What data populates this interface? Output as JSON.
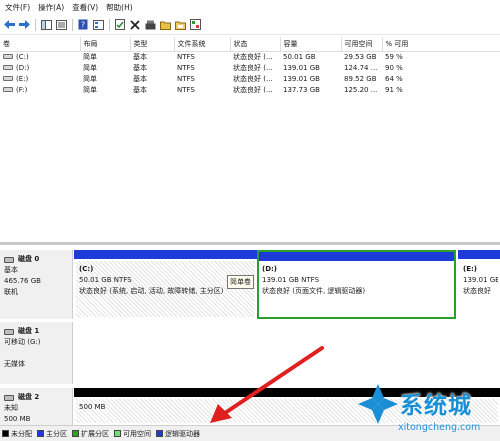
{
  "menu": [
    "文件(F)",
    "操作(A)",
    "查看(V)",
    "帮助(H)"
  ],
  "toolbar_icons": [
    "back-icon",
    "forward-icon",
    "console-tree-icon",
    "properties-icon",
    "help-icon",
    "refresh-icon",
    "delete-icon",
    "open-icon",
    "folder-icon",
    "export-icon",
    "settings-icon"
  ],
  "volume_table": {
    "columns": [
      "卷",
      "布局",
      "类型",
      "文件系统",
      "状态",
      "容量",
      "可用空间",
      "% 可用"
    ],
    "rows": [
      {
        "volume": "(C:)",
        "layout": "简单",
        "type": "基本",
        "fs": "NTFS",
        "status": "状态良好 (...",
        "capacity": "50.01 GB",
        "free": "29.53 GB",
        "pct": "59 %"
      },
      {
        "volume": "(D:)",
        "layout": "简单",
        "type": "基本",
        "fs": "NTFS",
        "status": "状态良好 (...",
        "capacity": "139.01 GB",
        "free": "124.74 ...",
        "pct": "90 %"
      },
      {
        "volume": "(E:)",
        "layout": "简单",
        "type": "基本",
        "fs": "NTFS",
        "status": "状态良好 (...",
        "capacity": "139.01 GB",
        "free": "89.52 GB",
        "pct": "64 %"
      },
      {
        "volume": "(F:)",
        "layout": "简单",
        "type": "基本",
        "fs": "NTFS",
        "status": "状态良好 (...",
        "capacity": "137.73 GB",
        "free": "125.20 ...",
        "pct": "91 %"
      }
    ]
  },
  "disks": [
    {
      "name": "磁盘 0",
      "type": "基本",
      "size": "465.76 GB",
      "state": "联机",
      "partitions": [
        {
          "name": "(C:)",
          "size_fs": "50.01 GB NTFS",
          "status": "状态良好 (系统, 启动, 活动, 故障转储, 主分区)"
        },
        {
          "name": "(D:)",
          "size_fs": "139.01 GB NTFS",
          "status": "状态良好 (页面文件, 逻辑驱动器)"
        },
        {
          "name": "(E:)",
          "size_fs": "139.01 GB",
          "status": "状态良好"
        }
      ],
      "tooltip": "简单卷"
    },
    {
      "name": "磁盘 1",
      "type": "可移动 (G:)",
      "state": "无媒体"
    },
    {
      "name": "磁盘 2",
      "type": "未知",
      "size": "500 MB",
      "partitions": [
        {
          "size": "500 MB"
        }
      ]
    }
  ],
  "legend": [
    {
      "label": "未分配",
      "color": "#000000"
    },
    {
      "label": "主分区",
      "color": "#1c3bd8"
    },
    {
      "label": "扩展分区",
      "color": "#2aa02a"
    },
    {
      "label": "可用空间",
      "color": "#70e070"
    },
    {
      "label": "逻辑驱动器",
      "color": "#1c3bd8"
    }
  ],
  "watermark": {
    "text": "系统城",
    "url": "xitongcheng.com"
  }
}
